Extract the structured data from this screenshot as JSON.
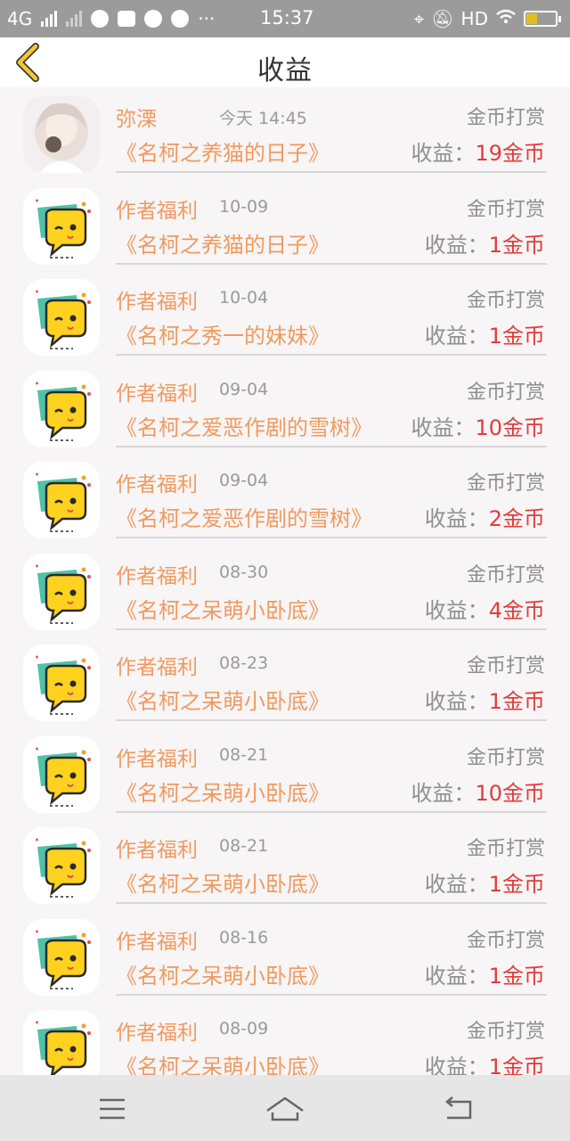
{
  "status_bar": {
    "network": "4G",
    "time": "15:37",
    "hd": "HD"
  },
  "header": {
    "title": "收益"
  },
  "colors": {
    "accent": "#f09a60",
    "amount": "#e23b3b",
    "gray": "#8f8f8f"
  },
  "earn_label": "收益：",
  "items": [
    {
      "name": "弥溧",
      "date": "今天 14:45",
      "type": "金币打赏",
      "book": "《名柯之养猫的日子》",
      "amount": "19金币",
      "avatar": "girl-avatar"
    },
    {
      "name": "作者福利",
      "date": "10-09",
      "type": "金币打赏",
      "book": "《名柯之养猫的日子》",
      "amount": "1金币",
      "avatar": "chat-bubble-avatar"
    },
    {
      "name": "作者福利",
      "date": "10-04",
      "type": "金币打赏",
      "book": "《名柯之秀一的妹妹》",
      "amount": "1金币",
      "avatar": "chat-bubble-avatar"
    },
    {
      "name": "作者福利",
      "date": "09-04",
      "type": "金币打赏",
      "book": "《名柯之爱恶作剧的雪树》",
      "amount": "10金币",
      "avatar": "chat-bubble-avatar"
    },
    {
      "name": "作者福利",
      "date": "09-04",
      "type": "金币打赏",
      "book": "《名柯之爱恶作剧的雪树》",
      "amount": "2金币",
      "avatar": "chat-bubble-avatar"
    },
    {
      "name": "作者福利",
      "date": "08-30",
      "type": "金币打赏",
      "book": "《名柯之呆萌小卧底》",
      "amount": "4金币",
      "avatar": "chat-bubble-avatar"
    },
    {
      "name": "作者福利",
      "date": "08-23",
      "type": "金币打赏",
      "book": "《名柯之呆萌小卧底》",
      "amount": "1金币",
      "avatar": "chat-bubble-avatar"
    },
    {
      "name": "作者福利",
      "date": "08-21",
      "type": "金币打赏",
      "book": "《名柯之呆萌小卧底》",
      "amount": "10金币",
      "avatar": "chat-bubble-avatar"
    },
    {
      "name": "作者福利",
      "date": "08-21",
      "type": "金币打赏",
      "book": "《名柯之呆萌小卧底》",
      "amount": "1金币",
      "avatar": "chat-bubble-avatar"
    },
    {
      "name": "作者福利",
      "date": "08-16",
      "type": "金币打赏",
      "book": "《名柯之呆萌小卧底》",
      "amount": "1金币",
      "avatar": "chat-bubble-avatar"
    },
    {
      "name": "作者福利",
      "date": "08-09",
      "type": "金币打赏",
      "book": "《名柯之呆萌小卧底》",
      "amount": "1金币",
      "avatar": "chat-bubble-avatar"
    }
  ]
}
